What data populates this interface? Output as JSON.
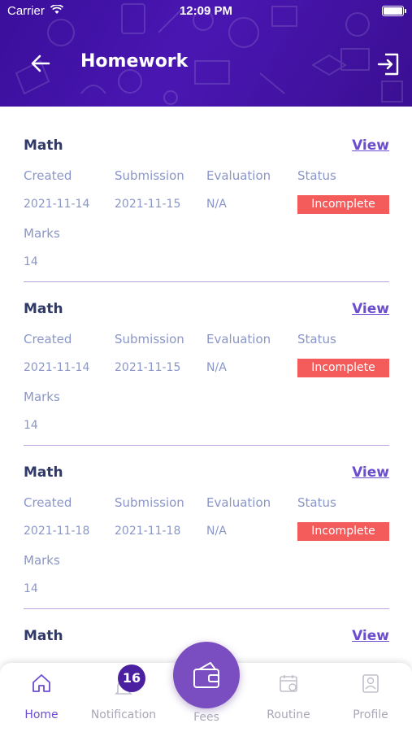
{
  "status_bar": {
    "carrier": "Carrier",
    "time": "12:09 PM"
  },
  "header": {
    "title": "Homework"
  },
  "labels": {
    "created": "Created",
    "submission": "Submission",
    "evaluation": "Evaluation",
    "status": "Status",
    "marks": "Marks",
    "view": "View"
  },
  "homework": [
    {
      "subject": "Math",
      "created": "2021-11-14",
      "submission": "2021-11-15",
      "evaluation": "N/A",
      "status": "Incomplete",
      "marks": "14"
    },
    {
      "subject": "Math",
      "created": "2021-11-14",
      "submission": "2021-11-15",
      "evaluation": "N/A",
      "status": "Incomplete",
      "marks": "14"
    },
    {
      "subject": "Math",
      "created": "2021-11-18",
      "submission": "2021-11-18",
      "evaluation": "N/A",
      "status": "Incomplete",
      "marks": "14"
    },
    {
      "subject": "Math",
      "created": "",
      "submission": "",
      "evaluation": "",
      "status": "",
      "marks": ""
    }
  ],
  "tabbar": {
    "home": "Home",
    "notification": "Notification",
    "notification_count": "16",
    "fees": "Fees",
    "routine": "Routine",
    "profile": "Profile"
  },
  "colors": {
    "primary": "#4a16b3",
    "accent": "#6c4dd0",
    "badge": "#f45b5b"
  },
  "icons": [
    "back-arrow-icon",
    "logout-icon",
    "home-icon",
    "bell-icon",
    "wallet-icon",
    "calendar-icon",
    "profile-card-icon",
    "wifi-icon",
    "battery-icon"
  ]
}
